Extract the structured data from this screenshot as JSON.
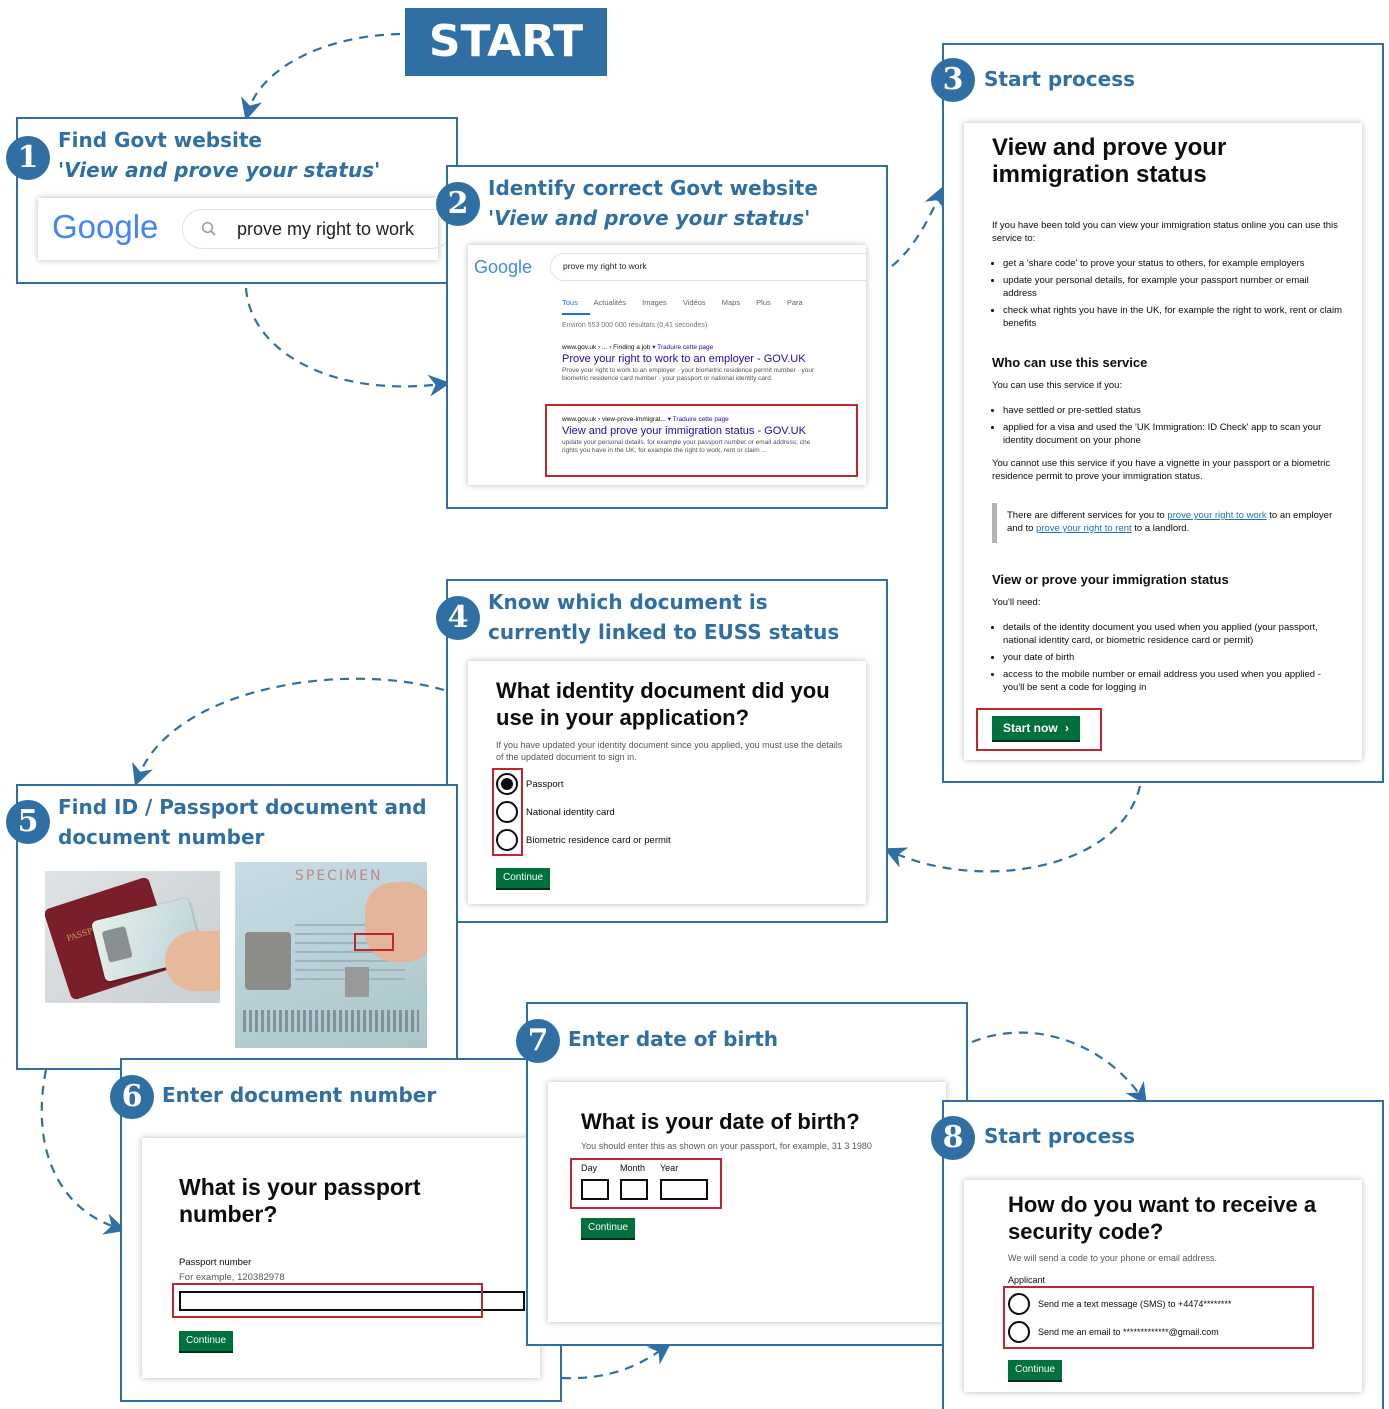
{
  "start_label": "START",
  "steps": {
    "s1": {
      "number": "1",
      "title": "Find Govt website",
      "subtitle": "'View and prove your status'",
      "google_logo": "Google",
      "search_icon": "search-icon",
      "search_text": "prove my right to work"
    },
    "s2": {
      "number": "2",
      "title": "Identify correct Govt website",
      "subtitle": "'View and prove your status'",
      "google_logo": "Google",
      "search_text": "prove my right to work",
      "tabs": [
        "Tous",
        "Actualités",
        "Images",
        "Vidéos",
        "Maps",
        "Plus",
        "Para"
      ],
      "result_count": "Environ 553 000 000 résultats (0,41 secondes)",
      "result1": {
        "breadcrumb": "www.gov.uk › ... › Finding a job",
        "translate": "▾ Traduire cette page",
        "title": "Prove your right to work to an employer - GOV.UK",
        "snippet1": "Prove your right to work to an employer · your biometric residence permit number · your",
        "snippet2": "biometric residence card number · your passport or national identity card."
      },
      "result2": {
        "breadcrumb": "www.gov.uk › view-prove-immigrat...",
        "translate": "▾ Traduire cette page",
        "title": "View and prove your immigration status - GOV.UK",
        "snippet1": "update your personal details, for example your passport number or email address; che",
        "snippet2": "rights you have in the UK, for example the right to work, rent or claim ..."
      }
    },
    "s3": {
      "number": "3",
      "title": "Start process",
      "heading": "View and prove your immigration status",
      "intro": "If you have been told you can view your immigration status online you can use this service to:",
      "list1": [
        "get a 'share code' to prove your status to others, for example employers",
        "update your personal details, for example your passport number or email address",
        "check what rights you have in the UK, for example the right to work, rent or claim benefits"
      ],
      "who_heading": "Who can use this service",
      "who_intro": "You can use this service if you:",
      "list2": [
        "have settled or pre-settled status",
        "applied for a visa and used the 'UK Immigration: ID Check' app to scan your identity document on your phone"
      ],
      "cannot": "You cannot use this service if you have a vignette in your passport or a biometric residence permit to prove your immigration status.",
      "inset_pre": "There are different services for you to ",
      "inset_link1": "prove your right to work",
      "inset_mid": " to an employer and to ",
      "inset_link2": "prove your right to rent",
      "inset_post": " to a landlord.",
      "view_heading": "View or prove your immigration status",
      "need": "You'll need:",
      "list3": [
        "details of the identity document you used when you applied (your passport, national identity card, or biometric residence card or permit)",
        "your date of birth",
        "access to the mobile number or email address you used when you applied - you'll be sent a code for logging in"
      ],
      "start_button": "Start now"
    },
    "s4": {
      "number": "4",
      "title_line1": "Know which document is",
      "title_line2": "currently linked to EUSS status",
      "heading": "What identity document did you use in your application?",
      "hint": "If you have updated your identity document since you applied, you must use the details of the updated document to sign in.",
      "options": [
        "Passport",
        "National identity card",
        "Biometric residence card or permit"
      ],
      "button": "Continue"
    },
    "s5": {
      "number": "5",
      "title_line1": "Find ID / Passport document and",
      "title_line2": "document number",
      "photo1_text": "PASSPORT",
      "photo2_text": "SPECIMEN"
    },
    "s6": {
      "number": "6",
      "title": "Enter document number",
      "heading": "What is your passport number?",
      "label": "Passport number",
      "hint": "For example, 120382978",
      "button": "Continue"
    },
    "s7": {
      "number": "7",
      "title": "Enter date of birth",
      "heading": "What is your date of birth?",
      "hint": "You should enter this as shown on your passport, for example, 31 3 1980",
      "fields": [
        "Day",
        "Month",
        "Year"
      ],
      "button": "Continue"
    },
    "s8": {
      "number": "8",
      "title": "Start process",
      "heading": "How do you want to receive a security code?",
      "hint": "We will send a code to your phone or email address.",
      "legend": "Applicant",
      "options": [
        "Send me a text message (SMS) to +4474********",
        "Send me an email to *************@gmail.com"
      ],
      "button": "Continue"
    }
  },
  "colors": {
    "accent_blue": "#2f6fa3",
    "govuk_green": "#00703c",
    "highlight_red": "#c1262d",
    "google_blue": "#1a0dab"
  }
}
